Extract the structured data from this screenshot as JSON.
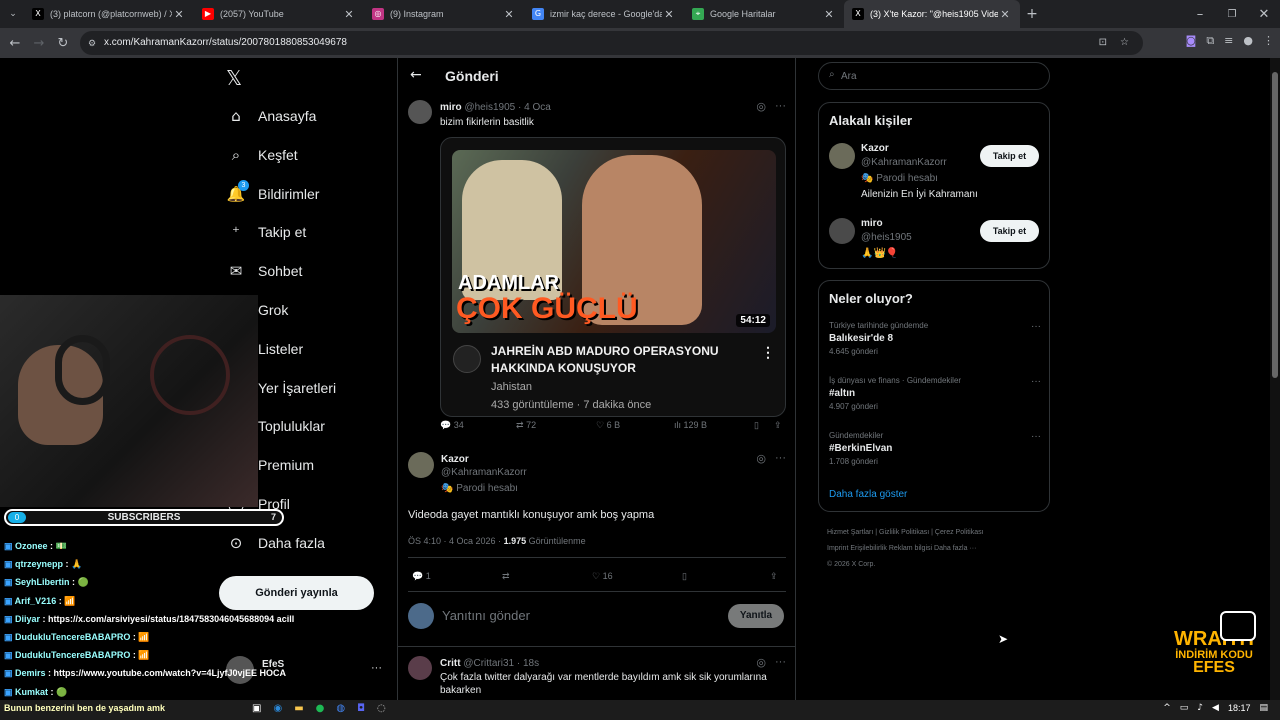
{
  "browser": {
    "tabs": [
      {
        "title": "(3) platcorn (@platcornweb) / X",
        "icon": "x-icon",
        "color": "#000"
      },
      {
        "title": "(2057) YouTube",
        "icon": "youtube-icon",
        "color": "#f00"
      },
      {
        "title": "(9) Instagram",
        "icon": "instagram-icon",
        "color": "#c13584"
      },
      {
        "title": "izmir kaç derece - Google'da Ara",
        "icon": "google-icon",
        "color": "#4285f4"
      },
      {
        "title": "Google Haritalar",
        "icon": "maps-icon",
        "color": "#34a853"
      },
      {
        "title": "(3) X'te Kazor: \"@heis1905 Vide",
        "icon": "x-icon",
        "color": "#000"
      }
    ],
    "url": "x.com/KahramanKazorr/status/2007801880853049678"
  },
  "nav": {
    "items": [
      "Anasayfa",
      "Keşfet",
      "Bildirimler",
      "Takip et",
      "Sohbet",
      "Grok",
      "Listeler",
      "Yer İşaretleri",
      "Topluluklar",
      "Premium",
      "Profil",
      "Daha fazla"
    ],
    "notif_badge": "3",
    "post_button": "Gönderi yayınla",
    "account_name": "EfeS"
  },
  "header": {
    "title": "Gönderi"
  },
  "quoted_post": {
    "name": "miro",
    "handle": "@heis1905",
    "date": "4 Oca",
    "text": "bizim fikirlerin basitlik",
    "video": {
      "overlay_line1": "ADAMLAR",
      "overlay_line2": "ÇOK GÜÇLÜ",
      "duration": "54:12",
      "title": "JAHREİN ABD MADURO OPERASYONU HAKKINDA KONUŞUYOR",
      "channel": "Jahistan",
      "stats": "433 görüntüleme · 7 dakika önce"
    },
    "replies": "34",
    "reposts": "72",
    "likes": "6 B",
    "views": "129 B"
  },
  "main_post": {
    "name": "Kazor",
    "handle": "@KahramanKazorr",
    "badge": "Parodi hesabı",
    "text": "Videoda gayet mantıklı konuşuyor amk boş yapma",
    "time": "ÖS 4:10 · 4 Oca 2026 · ",
    "views": "1.975",
    "views_label": " Görüntülenme",
    "replies": "1",
    "likes": "16"
  },
  "reply_box": {
    "placeholder": "Yanıtını gönder",
    "button": "Yanıtla"
  },
  "next_reply": {
    "name": "Critt",
    "handle": "@Crittari31",
    "date": "18s",
    "text": "Çok fazla twitter dalyarağı var mentlerde bayıldım amk sik sik yorumlarına bakarken"
  },
  "search": {
    "placeholder": "Ara"
  },
  "related": {
    "title": "Alakalı kişiler",
    "people": [
      {
        "name": "Kazor",
        "handle": "@KahramanKazorr",
        "badge": "Parodi hesabı",
        "bio": "Ailenizin En İyi Kahramanı",
        "button": "Takip et"
      },
      {
        "name": "miro",
        "handle": "@heis1905",
        "bio": "🙏👑🎈",
        "button": "Takip et"
      }
    ]
  },
  "trends": {
    "title": "Neler oluyor?",
    "items": [
      {
        "context": "Türkiye tarihinde gündemde",
        "name": "Balıkesir'de 8",
        "count": "4.645 gönderi"
      },
      {
        "context": "İş dünyası ve finans · Gündemdekiler",
        "name": "#altın",
        "count": "4.907 gönderi"
      },
      {
        "context": "Gündemdekiler",
        "name": "#BerkinElvan",
        "count": "1.708 gönderi"
      }
    ],
    "more": "Daha fazla göster"
  },
  "footer": {
    "line1": [
      "Hizmet Şartları",
      "Gizlilik Politikası",
      "Çerez Politikası"
    ],
    "line2": [
      "Imprint",
      "Erişilebilirlik",
      "Reklam bilgisi",
      "Daha fazla ···"
    ],
    "line3": "© 2026 X Corp."
  },
  "overlay": {
    "subs_left": "0",
    "subs_label": "SUBSCRIBERS",
    "subs_right": "7",
    "chat": [
      {
        "user": "Ozonee",
        "msg": "💵"
      },
      {
        "user": "qtrzeynepp",
        "msg": "🙏"
      },
      {
        "user": "SeyhLibertin",
        "msg": "🟢"
      },
      {
        "user": "Arif_V216",
        "msg": "📶"
      },
      {
        "user": "Diiyar",
        "msg": "https://x.com/arsiviyesi/status/1847583046045688094 acill"
      },
      {
        "user": "DudukluTencereBABAPRO",
        "msg": "📶"
      },
      {
        "user": "DudukluTencereBABAPRO",
        "msg": "📶"
      },
      {
        "user": "Demirs",
        "msg": "https://www.youtube.com/watch?v=4LjyfJ0vjEE HOCA"
      },
      {
        "user": "Kumkat",
        "msg": "🟢"
      }
    ],
    "ticker": "Bunun benzerini ben de yaşadım amk",
    "brand1": "WRAITH",
    "brand2": "İNDİRİM KODU",
    "brand3": "EFES"
  },
  "taskbar": {
    "time": "18:17"
  }
}
